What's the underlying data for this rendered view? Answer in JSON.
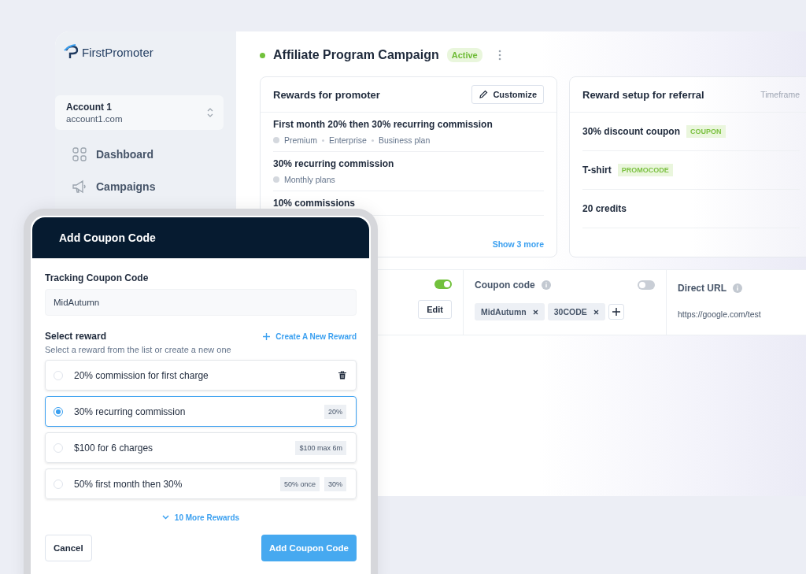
{
  "sidebar": {
    "logo": "FirstPromoter",
    "account": {
      "name": "Account 1",
      "domain": "account1.com"
    },
    "items": [
      {
        "label": "Dashboard"
      },
      {
        "label": "Campaigns"
      }
    ]
  },
  "campaign": {
    "title": "Affiliate Program Campaign",
    "status": "Active",
    "active": true
  },
  "promoter_card": {
    "title": "Rewards for promoter",
    "button": "Customize",
    "link": "Show 3 more",
    "rewards": [
      {
        "title": "First month 20% then 30% recurring commission",
        "plans": [
          "Premium",
          "Enterprise",
          "Business plan"
        ]
      },
      {
        "title": "30% recurring commission",
        "plans": [
          "Monthly plans"
        ]
      },
      {
        "title": "10% commissions"
      }
    ]
  },
  "referral_card": {
    "title": "Reward setup for referral",
    "column_2": "Timeframe",
    "rewards": [
      {
        "title": "30% discount coupon",
        "tag": "COUPON"
      },
      {
        "title": "T-shirt",
        "tag": "PROMOCODE"
      },
      {
        "title": "20 credits"
      }
    ]
  },
  "tracking": [
    {
      "kind": "toggle",
      "on": true,
      "button": "Edit"
    },
    {
      "kind": "tags",
      "label": "Coupon code",
      "on": false,
      "tags": [
        "MidAutumn",
        "30CODE"
      ]
    },
    {
      "kind": "url",
      "label": "Direct URL",
      "value": "https://google.com/test"
    }
  ],
  "modal": {
    "title": "Add Coupon Code",
    "code_label": "Tracking Coupon Code",
    "code_value": "MidAutumn",
    "reward_label": "Select reward",
    "reward_hint": "Select a reward from the list or create a new one",
    "create_link": "Create A New Reward",
    "options": [
      {
        "label": "20% commission for first charge",
        "selected": false,
        "deletable": true
      },
      {
        "label": "30% recurring commission",
        "selected": true,
        "deletable": false,
        "badges": [
          "20%"
        ]
      },
      {
        "label": "$100 for 6 charges",
        "selected": false,
        "deletable": false,
        "badges": [
          "$100 max 6m"
        ]
      },
      {
        "label": "50% first month then 30%",
        "selected": false,
        "deletable": false,
        "badges": [
          "50% once",
          "30%"
        ]
      }
    ],
    "more": "10 More Rewards",
    "cancel": "Cancel",
    "submit": "Add Coupon Code"
  }
}
